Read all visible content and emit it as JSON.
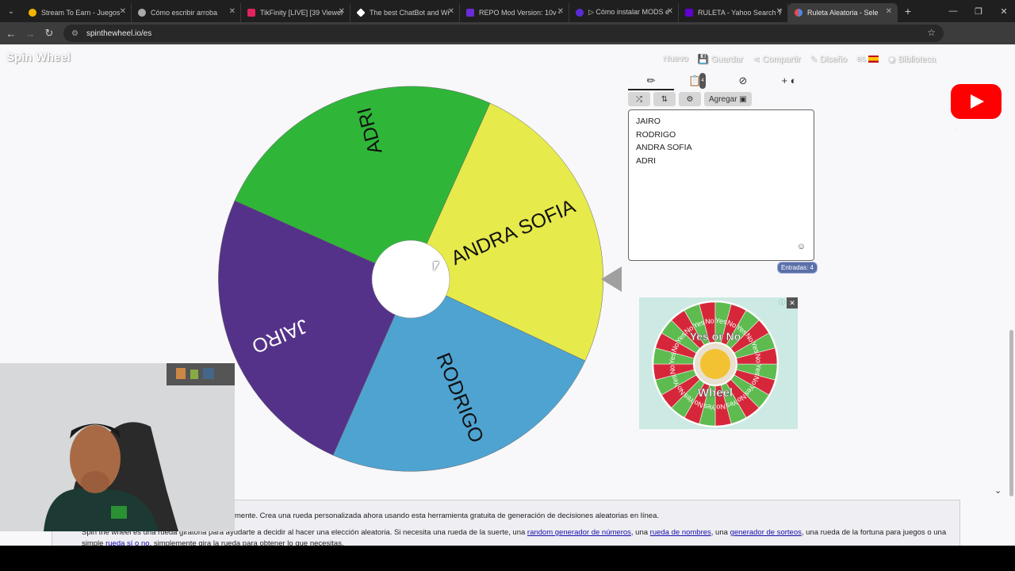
{
  "browser": {
    "tabs": [
      {
        "title": "Stream To Earn - Juegos",
        "color": "#f5b400"
      },
      {
        "title": "Cómo escribir arroba",
        "color": "#aaaaaa"
      },
      {
        "title": "TikFinity [LIVE] [39 Viewer",
        "color": "#e0245e"
      },
      {
        "title": "The best ChatBot and Wi",
        "color": "#ffffff"
      },
      {
        "title": "REPO Mod Version: 10v -",
        "color": "#6b2bd9"
      },
      {
        "title": "▷ Cómo instalar MODS e",
        "color": "#5a2bd9"
      },
      {
        "title": "RULETA - Yahoo Search T",
        "color": "#6001d2"
      },
      {
        "title": "Ruleta Aleatoria - Sele",
        "color": "#e84a4a"
      }
    ],
    "url": "spinthewheel.io/es"
  },
  "site": {
    "logo": "Spin Wheel",
    "nav": {
      "new": "Nuevo",
      "save": "Guardar",
      "share": "Compartir",
      "design": "Diseño",
      "lang": "es",
      "library": "Biblioteca"
    }
  },
  "wheel": {
    "segments": [
      {
        "label": "ANDRA SOFIA",
        "color": "#e6ea4b"
      },
      {
        "label": "RODRIGO",
        "color": "#4fa3d1"
      },
      {
        "label": "JAIRO",
        "color": "#553289"
      },
      {
        "label": "ADRI",
        "color": "#2fb639"
      }
    ]
  },
  "editor": {
    "add_label": "Agregar",
    "badge": "4",
    "entries": [
      "JAIRO",
      "RODRIGO",
      "ANDRA SOFIA",
      "ADRI"
    ],
    "count_label": "Entradas: 4"
  },
  "ad": {
    "title": "Yes or No",
    "subtitle": "Wheel",
    "close": "✕",
    "words": [
      "Yes",
      "No"
    ]
  },
  "description": {
    "line1": "mente. Crea una rueda personalizada ahora usando esta herramienta gratuita de generación de decisiones aleatorias en línea.",
    "line2_pre": "Spin the wheel es una rueda giratoria para ayudarte a decidir al hacer una elección aleatoria. Si necesita una rueda de la suerte, una ",
    "link_numbers": "random generador de números",
    "line2_mid1": ", una ",
    "link_names": "rueda de nombres",
    "line2_mid2": ", una ",
    "link_raffle": "generador de sorteos",
    "line2_post": ", una rueda de la fortuna para juegos o una",
    "line3_pre": "simple ",
    "link_yesno": "rueda sí o no",
    "line3_post": ", simplemente gira la rueda para obtener lo que necesitas."
  }
}
